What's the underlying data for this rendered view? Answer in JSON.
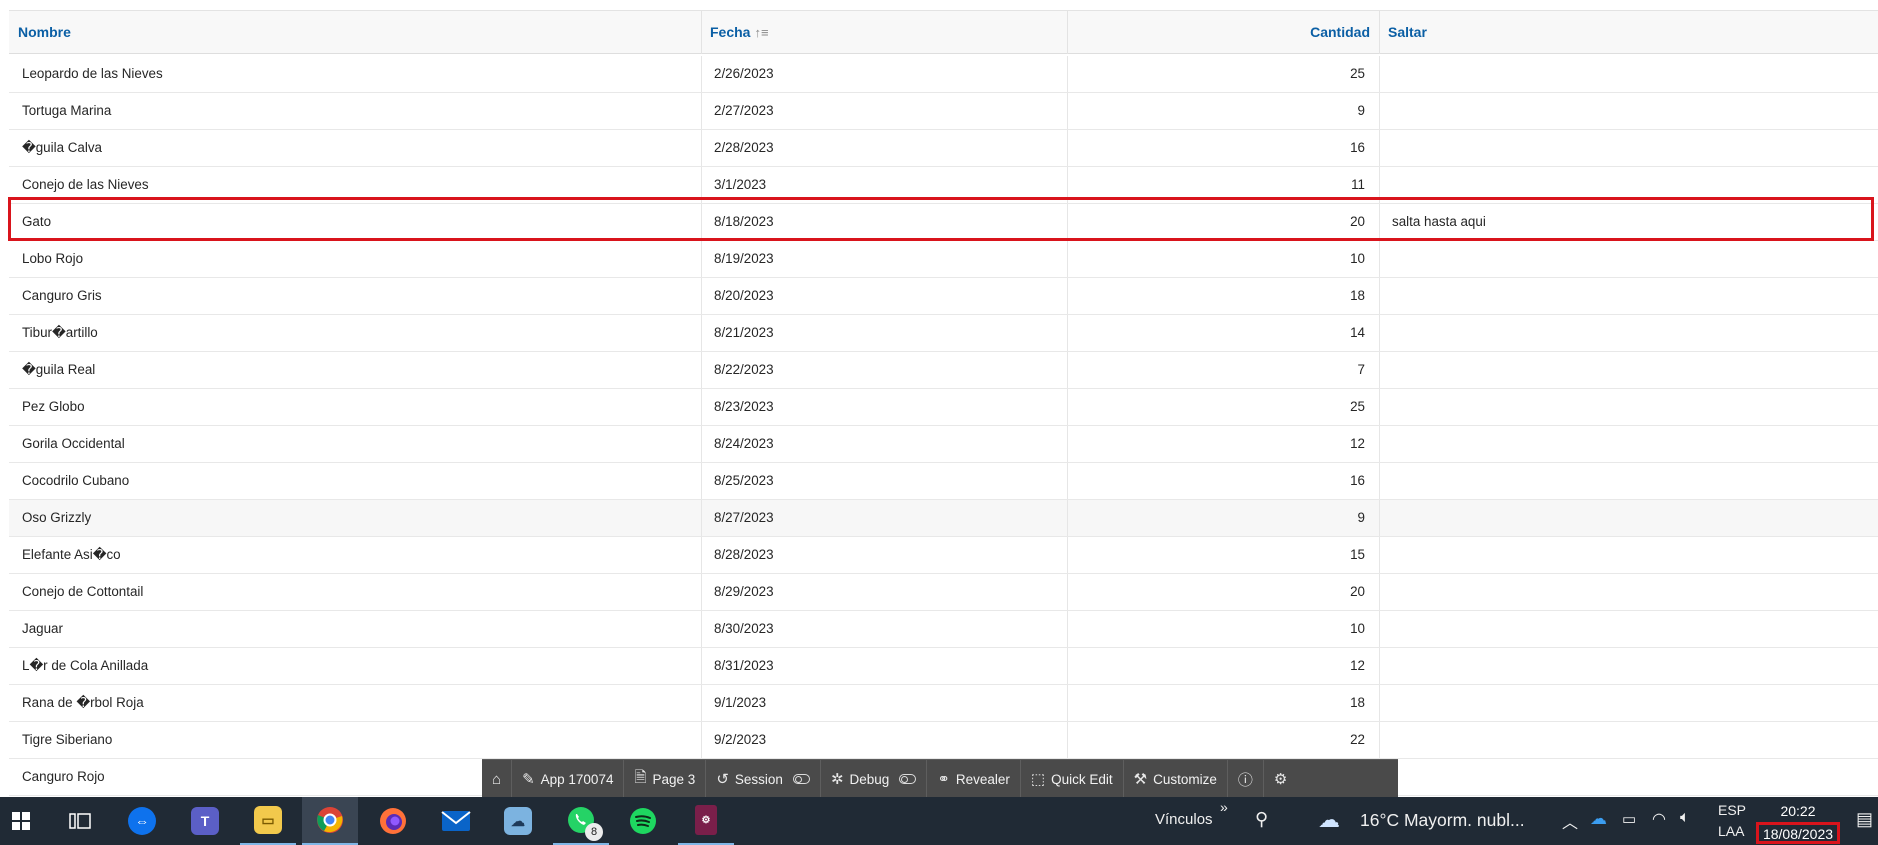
{
  "grid": {
    "headers": {
      "name": "Nombre",
      "date": "Fecha",
      "sort_icon": "sort-ascending-icon",
      "qty": "Cantidad",
      "skip": "Saltar"
    },
    "rows": [
      {
        "name": "Leopardo de las Nieves",
        "date": "2/26/2023",
        "qty": "25",
        "skip": ""
      },
      {
        "name": "Tortuga Marina",
        "date": "2/27/2023",
        "qty": "9",
        "skip": ""
      },
      {
        "name": "�guila Calva",
        "date": "2/28/2023",
        "qty": "16",
        "skip": ""
      },
      {
        "name": "Conejo de las Nieves",
        "date": "3/1/2023",
        "qty": "11",
        "skip": ""
      },
      {
        "name": "Gato",
        "date": "8/18/2023",
        "qty": "20",
        "skip": "salta hasta aqui"
      },
      {
        "name": "Lobo Rojo",
        "date": "8/19/2023",
        "qty": "10",
        "skip": ""
      },
      {
        "name": "Canguro Gris",
        "date": "8/20/2023",
        "qty": "18",
        "skip": ""
      },
      {
        "name": "Tibur�artillo",
        "date": "8/21/2023",
        "qty": "14",
        "skip": ""
      },
      {
        "name": "�guila Real",
        "date": "8/22/2023",
        "qty": "7",
        "skip": ""
      },
      {
        "name": "Pez Globo",
        "date": "8/23/2023",
        "qty": "25",
        "skip": ""
      },
      {
        "name": "Gorila Occidental",
        "date": "8/24/2023",
        "qty": "12",
        "skip": ""
      },
      {
        "name": "Cocodrilo Cubano",
        "date": "8/25/2023",
        "qty": "16",
        "skip": ""
      },
      {
        "name": "Oso Grizzly",
        "date": "8/27/2023",
        "qty": "9",
        "skip": ""
      },
      {
        "name": "Elefante Asi�co",
        "date": "8/28/2023",
        "qty": "15",
        "skip": ""
      },
      {
        "name": "Conejo de Cottontail",
        "date": "8/29/2023",
        "qty": "20",
        "skip": ""
      },
      {
        "name": "Jaguar",
        "date": "8/30/2023",
        "qty": "10",
        "skip": ""
      },
      {
        "name": "L�r de Cola Anillada",
        "date": "8/31/2023",
        "qty": "12",
        "skip": ""
      },
      {
        "name": "Rana de �rbol Roja",
        "date": "9/1/2023",
        "qty": "18",
        "skip": ""
      },
      {
        "name": "Tigre Siberiano",
        "date": "9/2/2023",
        "qty": "22",
        "skip": ""
      },
      {
        "name": "Canguro Rojo",
        "date": "",
        "qty": "",
        "skip": ""
      }
    ],
    "highlighted_row": "Gato"
  },
  "devbar": {
    "home_icon": "home-icon",
    "app": "App 170074",
    "page": "Page 3",
    "session": "Session",
    "debug": "Debug",
    "revealer": "Revealer",
    "quick_edit": "Quick Edit",
    "customize": "Customize",
    "info_icon": "info-icon",
    "settings_icon": "gear-icon"
  },
  "taskbar": {
    "apps": [
      "windows-start",
      "task-view",
      "teamviewer",
      "teams",
      "file-explorer",
      "chrome",
      "firefox",
      "mail",
      "weather-app",
      "whatsapp",
      "spotify",
      "app-generic"
    ],
    "whatsapp_badge": "8",
    "links_label": "Vínculos",
    "links_chevron": "»",
    "weather": "16°C  Mayorm. nubl...",
    "lang_top": "ESP",
    "lang_bottom": "LAA",
    "time": "20:22",
    "date": "18/08/2023"
  },
  "colors": {
    "header_text": "#0b5fa5",
    "highlight": "#d9141c",
    "devbar_bg": "#4a4a4a",
    "taskbar_bg": "#202a35"
  }
}
